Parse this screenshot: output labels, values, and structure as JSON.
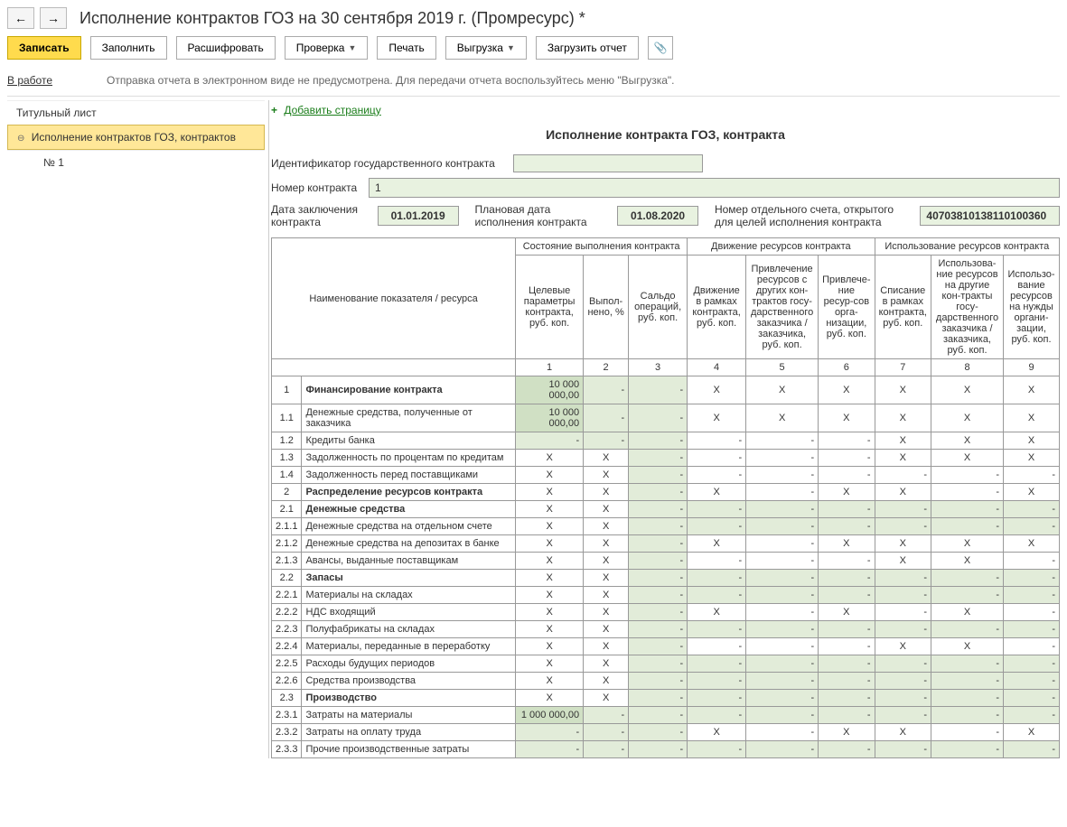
{
  "title": "Исполнение контрактов ГОЗ на 30 сентября 2019 г. (Промресурс) *",
  "toolbar": {
    "save": "Записать",
    "fill": "Заполнить",
    "decrypt": "Расшифровать",
    "check": "Проверка",
    "print": "Печать",
    "export": "Выгрузка",
    "load": "Загрузить отчет"
  },
  "status": {
    "link": "В работе",
    "msg": "Отправка отчета в электронном виде не предусмотрена. Для передачи отчета воспользуйтесь меню \"Выгрузка\"."
  },
  "sidebar": {
    "title_page": "Титульный лист",
    "contracts": "Исполнение контрактов ГОЗ, контрактов",
    "child1": "№ 1"
  },
  "addPage": "Добавить страницу",
  "sectionTitle": "Исполнение контракта ГОЗ, контракта",
  "form": {
    "idLabel": "Идентификатор государственного контракта",
    "idValue": "",
    "numLabel": "Номер контракта",
    "numValue": "1",
    "dateLabel": "Дата заключения контракта",
    "dateValue": "01.01.2019",
    "planLabel": "Плановая дата исполнения контракта",
    "planValue": "01.08.2020",
    "accLabel": "Номер отдельного счета, открытого для целей исполнения контракта",
    "accValue": "40703810138110100360"
  },
  "headers": {
    "nameCol": "Наименование показателя / ресурса",
    "grp1": "Состояние выполнения контракта",
    "grp2": "Движение ресурсов контракта",
    "grp3": "Использование ресурсов контракта",
    "c1": "Целевые параметры контракта, руб. коп.",
    "c2": "Выпол-нено, %",
    "c3": "Сальдо операций, руб. коп.",
    "c4": "Движение в рамках контракта, руб. коп.",
    "c5": "Привлечение ресурсов с других кон-трактов госу-дарственного заказчика / заказчика, руб. коп.",
    "c6": "Привлече-ние ресур-сов орга-низации, руб. коп.",
    "c7": "Списание в рамках контракта, руб. коп.",
    "c8": "Использова-ние ресурсов на другие кон-тракты госу-дарственного заказчика / заказчика, руб. коп.",
    "c9": "Использо-вание ресурсов на нужды органи-зации, руб. коп."
  },
  "colnums": [
    "1",
    "2",
    "3",
    "4",
    "5",
    "6",
    "7",
    "8",
    "9"
  ],
  "rows": [
    {
      "n": "1",
      "name": "Финансирование контракта",
      "bold": true,
      "v1": "10 000 000,00",
      "g": [
        1,
        2,
        3
      ],
      "c": [
        2,
        3
      ],
      "x": [
        4,
        5,
        6,
        7,
        8,
        9
      ],
      "d": []
    },
    {
      "n": "1.1",
      "name": "Денежные средства, полученные от заказчика",
      "v1": "10 000 000,00",
      "g": [
        1,
        2,
        3
      ],
      "c": [
        2,
        3
      ],
      "x": [
        4,
        5,
        6,
        7,
        8,
        9
      ],
      "d": []
    },
    {
      "n": "1.2",
      "name": "Кредиты банка",
      "g": [
        1,
        2,
        3
      ],
      "c": [
        1,
        2,
        3
      ],
      "x": [
        7,
        8,
        9
      ],
      "d": [
        4,
        5,
        6
      ]
    },
    {
      "n": "1.3",
      "name": "Задолженность по процентам по кредитам",
      "c1x": true,
      "c2x": true,
      "g": [
        3
      ],
      "c": [
        3
      ],
      "x": [
        7,
        8,
        9
      ],
      "d": [
        4,
        5,
        6
      ]
    },
    {
      "n": "1.4",
      "name": "Задолженность перед поставщиками",
      "c1x": true,
      "c2x": true,
      "g": [
        3
      ],
      "c": [
        3
      ],
      "x": [],
      "d": [
        4,
        5,
        6,
        7,
        8,
        9
      ]
    },
    {
      "n": "2",
      "name": "Распределение ресурсов контракта",
      "bold": true,
      "c1x": true,
      "c2x": true,
      "g": [
        3
      ],
      "c": [
        3
      ],
      "x": [
        4,
        6,
        7,
        9
      ],
      "d": [
        5,
        8
      ]
    },
    {
      "n": "2.1",
      "name": "Денежные средства",
      "bold": true,
      "c1x": true,
      "c2x": true,
      "g": [
        3,
        4,
        5,
        6,
        7,
        8,
        9
      ],
      "c": [
        3,
        4,
        5,
        6,
        7,
        8,
        9
      ],
      "x": [],
      "d": []
    },
    {
      "n": "2.1.1",
      "name": "Денежные средства на отдельном счете",
      "c1x": true,
      "c2x": true,
      "g": [
        3,
        4,
        5,
        6,
        7,
        8,
        9
      ],
      "c": [
        3,
        4,
        5,
        6,
        7,
        8,
        9
      ],
      "x": [],
      "d": []
    },
    {
      "n": "2.1.2",
      "name": "Денежные средства на депозитах в банке",
      "c1x": true,
      "c2x": true,
      "g": [
        3
      ],
      "c": [
        3
      ],
      "x": [
        4,
        6,
        7,
        8,
        9
      ],
      "d": [
        5
      ]
    },
    {
      "n": "2.1.3",
      "name": "Авансы, выданные поставщикам",
      "c1x": true,
      "c2x": true,
      "g": [
        3
      ],
      "c": [
        3
      ],
      "x": [
        7,
        8
      ],
      "d": [
        4,
        5,
        6,
        9
      ]
    },
    {
      "n": "2.2",
      "name": "Запасы",
      "bold": true,
      "c1x": true,
      "c2x": true,
      "g": [
        3,
        4,
        5,
        6,
        7,
        8,
        9
      ],
      "c": [
        3,
        4,
        5,
        6,
        7,
        8,
        9
      ],
      "x": [],
      "d": []
    },
    {
      "n": "2.2.1",
      "name": "Материалы на складах",
      "c1x": true,
      "c2x": true,
      "g": [
        3,
        4,
        5,
        6,
        7,
        8,
        9
      ],
      "c": [
        3,
        4,
        5,
        6,
        7,
        8,
        9
      ],
      "x": [],
      "d": []
    },
    {
      "n": "2.2.2",
      "name": "НДС входящий",
      "c1x": true,
      "c2x": true,
      "g": [
        3
      ],
      "c": [
        3
      ],
      "x": [
        4,
        6,
        8
      ],
      "d": [
        5,
        7,
        9
      ]
    },
    {
      "n": "2.2.3",
      "name": "Полуфабрикаты на складах",
      "c1x": true,
      "c2x": true,
      "g": [
        3,
        4,
        5,
        6,
        7,
        8,
        9
      ],
      "c": [
        3,
        4,
        5,
        6,
        7,
        8,
        9
      ],
      "x": [],
      "d": []
    },
    {
      "n": "2.2.4",
      "name": "Материалы, переданные в переработку",
      "c1x": true,
      "c2x": true,
      "g": [
        3
      ],
      "c": [
        3
      ],
      "x": [
        7,
        8
      ],
      "d": [
        4,
        5,
        6,
        9
      ]
    },
    {
      "n": "2.2.5",
      "name": "Расходы будущих периодов",
      "c1x": true,
      "c2x": true,
      "g": [
        3,
        4,
        5,
        6,
        7,
        8,
        9
      ],
      "c": [
        3,
        4,
        5,
        6,
        7,
        8,
        9
      ],
      "x": [],
      "d": []
    },
    {
      "n": "2.2.6",
      "name": "Средства производства",
      "c1x": true,
      "c2x": true,
      "g": [
        3,
        4,
        5,
        6,
        7,
        8,
        9
      ],
      "c": [
        3,
        4,
        5,
        6,
        7,
        8,
        9
      ],
      "x": [],
      "d": []
    },
    {
      "n": "2.3",
      "name": "Производство",
      "bold": true,
      "c1x": true,
      "c2x": true,
      "g": [
        3,
        4,
        5,
        6,
        7,
        8,
        9
      ],
      "c": [
        3,
        4,
        5,
        6,
        7,
        8,
        9
      ],
      "x": [],
      "d": []
    },
    {
      "n": "2.3.1",
      "name": "Затраты на материалы",
      "v1": "1 000 000,00",
      "g": [
        1,
        2,
        3,
        4,
        5,
        6,
        7,
        8,
        9
      ],
      "c": [
        2,
        3,
        4,
        5,
        6,
        7,
        8,
        9
      ],
      "x": [],
      "d": []
    },
    {
      "n": "2.3.2",
      "name": "Затраты на оплату труда",
      "g": [
        1,
        2,
        3
      ],
      "c": [
        1,
        2,
        3
      ],
      "x": [
        4,
        6,
        7,
        9
      ],
      "d": [
        5,
        8
      ]
    },
    {
      "n": "2.3.3",
      "name": "Прочие производственные затраты",
      "g": [
        1,
        2,
        3,
        4,
        5,
        6,
        7,
        8,
        9
      ],
      "c": [
        1,
        2,
        3,
        4,
        5,
        6,
        7,
        8,
        9
      ],
      "x": [],
      "d": []
    }
  ]
}
